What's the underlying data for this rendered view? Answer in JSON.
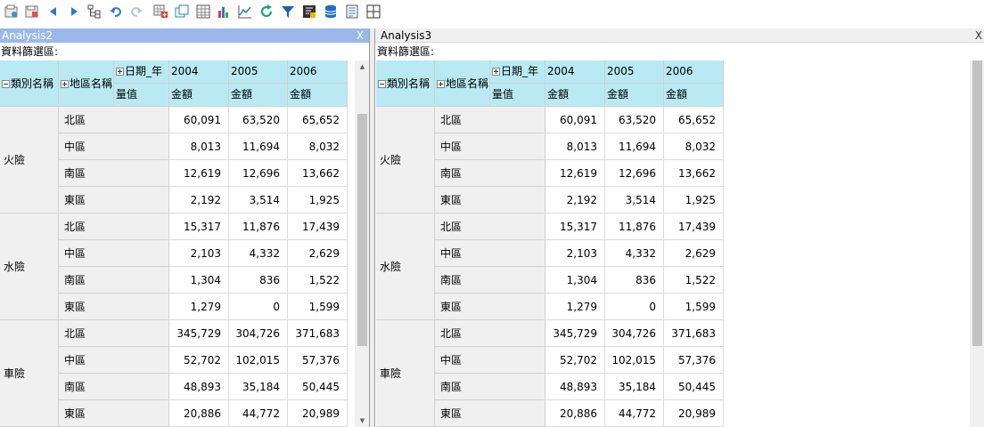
{
  "toolbar": {
    "icons": [
      "open-file-icon",
      "save-file-icon",
      "nav-back-icon",
      "nav-forward-icon",
      "tree-icon",
      "undo-icon",
      "redo-icon",
      "add-calc-icon",
      "copy-icon",
      "grid-view-icon",
      "bar-chart-icon",
      "line-chart-icon",
      "refresh-icon",
      "filter-icon",
      "sort-icon",
      "database-icon",
      "report-icon",
      "table-icon"
    ],
    "colors": {
      "accent_blue": "#2a78d2",
      "refresh_green": "#1aa37a"
    }
  },
  "panels": [
    {
      "title": "Analysis2",
      "close": "X",
      "filter_label": "資料篩選區:",
      "headers": {
        "category": "類別名稱",
        "region": "地區名稱",
        "date_dim": "日期_年",
        "measure_label": "量值",
        "years": [
          "2004",
          "2005",
          "2006"
        ],
        "amount": "金額"
      }
    },
    {
      "title": "Analysis3",
      "close": "X",
      "filter_label": "資料篩選區:",
      "headers": {
        "category": "類別名稱",
        "region": "地區名稱",
        "date_dim": "日期_年",
        "measure_label": "量值",
        "years": [
          "2004",
          "2005",
          "2006"
        ],
        "amount": "金額"
      }
    }
  ],
  "table": {
    "groups": [
      {
        "category": "火險",
        "rows": [
          {
            "region": "北區",
            "values": [
              "60,091",
              "63,520",
              "65,652"
            ]
          },
          {
            "region": "中區",
            "values": [
              "8,013",
              "11,694",
              "8,032"
            ]
          },
          {
            "region": "南區",
            "values": [
              "12,619",
              "12,696",
              "13,662"
            ]
          },
          {
            "region": "東區",
            "values": [
              "2,192",
              "3,514",
              "1,925"
            ]
          }
        ]
      },
      {
        "category": "水險",
        "rows": [
          {
            "region": "北區",
            "values": [
              "15,317",
              "11,876",
              "17,439"
            ]
          },
          {
            "region": "中區",
            "values": [
              "2,103",
              "4,332",
              "2,629"
            ]
          },
          {
            "region": "南區",
            "values": [
              "1,304",
              "836",
              "1,522"
            ]
          },
          {
            "region": "東區",
            "values": [
              "1,279",
              "0",
              "1,599"
            ]
          }
        ]
      },
      {
        "category": "車險",
        "rows": [
          {
            "region": "北區",
            "values": [
              "345,729",
              "304,726",
              "371,683"
            ]
          },
          {
            "region": "中區",
            "values": [
              "52,702",
              "102,015",
              "57,376"
            ]
          },
          {
            "region": "南區",
            "values": [
              "48,893",
              "35,184",
              "50,445"
            ]
          },
          {
            "region": "東區",
            "values": [
              "20,886",
              "44,772",
              "20,989"
            ]
          }
        ]
      }
    ]
  },
  "scrollbars": [
    {
      "thumb_start": 0.12,
      "thumb_size": 0.68
    },
    {
      "thumb_start": 0.0,
      "thumb_size": 0.78
    }
  ]
}
